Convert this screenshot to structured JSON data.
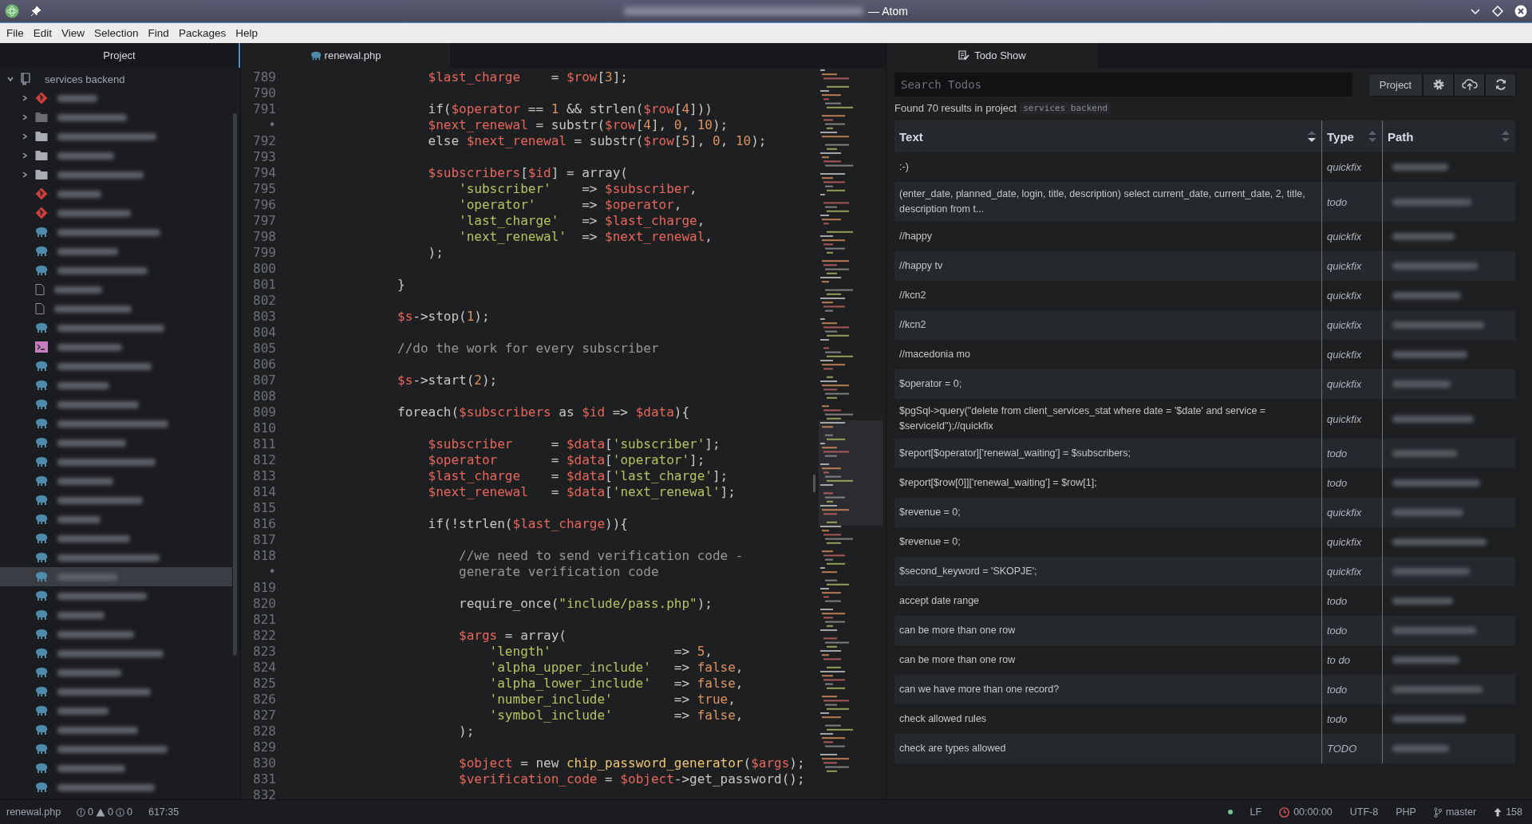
{
  "window": {
    "title": "— Atom"
  },
  "menu": [
    "File",
    "Edit",
    "View",
    "Selection",
    "Find",
    "Packages",
    "Help"
  ],
  "tree": {
    "tab": "Project",
    "root": {
      "label": "services backend",
      "expanded": true
    },
    "items": [
      {
        "kind": "git",
        "expanded": false,
        "selected": false
      },
      {
        "kind": "ignored",
        "expanded": false,
        "selected": false
      },
      {
        "kind": "folder",
        "expanded": false,
        "selected": false
      },
      {
        "kind": "folder",
        "expanded": false,
        "selected": false
      },
      {
        "kind": "folder",
        "expanded": false,
        "selected": false
      },
      {
        "kind": "gitfile",
        "selected": false
      },
      {
        "kind": "gitfile",
        "selected": false
      },
      {
        "kind": "php",
        "selected": false
      },
      {
        "kind": "php",
        "selected": false
      },
      {
        "kind": "php",
        "selected": false
      },
      {
        "kind": "file",
        "selected": false
      },
      {
        "kind": "file",
        "selected": false
      },
      {
        "kind": "php",
        "selected": false
      },
      {
        "kind": "shell",
        "selected": false
      },
      {
        "kind": "php",
        "selected": false
      },
      {
        "kind": "php",
        "selected": false
      },
      {
        "kind": "php",
        "selected": false
      },
      {
        "kind": "php",
        "selected": false
      },
      {
        "kind": "php",
        "selected": false
      },
      {
        "kind": "php",
        "selected": false
      },
      {
        "kind": "php",
        "selected": false
      },
      {
        "kind": "php",
        "selected": false
      },
      {
        "kind": "php",
        "selected": false
      },
      {
        "kind": "php",
        "selected": false
      },
      {
        "kind": "php",
        "selected": false
      },
      {
        "kind": "php",
        "selected": true
      },
      {
        "kind": "php",
        "selected": false
      },
      {
        "kind": "php",
        "selected": false
      },
      {
        "kind": "php",
        "selected": false
      },
      {
        "kind": "php",
        "selected": false
      },
      {
        "kind": "php",
        "selected": false
      },
      {
        "kind": "php",
        "selected": false
      },
      {
        "kind": "php",
        "selected": false
      },
      {
        "kind": "php",
        "selected": false
      },
      {
        "kind": "php",
        "selected": false
      },
      {
        "kind": "php",
        "selected": false
      },
      {
        "kind": "php",
        "selected": false
      }
    ]
  },
  "editor": {
    "tab": "renewal.php",
    "lines": [
      {
        "number": "789",
        "tokens": [
          {
            "kind": "var",
            "text": "    $last_charge"
          },
          {
            "kind": "plain",
            "text": "    = "
          },
          {
            "kind": "var",
            "text": "$row"
          },
          {
            "kind": "plain",
            "text": "["
          },
          {
            "kind": "num",
            "text": "3"
          },
          {
            "kind": "plain",
            "text": "];"
          }
        ]
      },
      {
        "number": "790"
      },
      {
        "number": "791",
        "tokens": [
          {
            "kind": "plain",
            "text": "    if("
          },
          {
            "kind": "var",
            "text": "$operator"
          },
          {
            "kind": "plain",
            "text": " == "
          },
          {
            "kind": "num",
            "text": "1"
          },
          {
            "kind": "plain",
            "text": " && strlen("
          },
          {
            "kind": "var",
            "text": "$row"
          },
          {
            "kind": "plain",
            "text": "["
          },
          {
            "kind": "num",
            "text": "4"
          },
          {
            "kind": "plain",
            "text": "]))"
          }
        ]
      },
      {
        "number": "•",
        "tokens": [
          {
            "kind": "var",
            "text": "    $next_renewal"
          },
          {
            "kind": "plain",
            "text": " = substr("
          },
          {
            "kind": "var",
            "text": "$row"
          },
          {
            "kind": "plain",
            "text": "["
          },
          {
            "kind": "num",
            "text": "4"
          },
          {
            "kind": "plain",
            "text": "], "
          },
          {
            "kind": "num",
            "text": "0"
          },
          {
            "kind": "plain",
            "text": ", "
          },
          {
            "kind": "num",
            "text": "10"
          },
          {
            "kind": "plain",
            "text": ");"
          }
        ]
      },
      {
        "number": "792",
        "tokens": [
          {
            "kind": "plain",
            "text": "    else "
          },
          {
            "kind": "var",
            "text": "$next_renewal"
          },
          {
            "kind": "plain",
            "text": " = substr("
          },
          {
            "kind": "var",
            "text": "$row"
          },
          {
            "kind": "plain",
            "text": "["
          },
          {
            "kind": "num",
            "text": "5"
          },
          {
            "kind": "plain",
            "text": "], "
          },
          {
            "kind": "num",
            "text": "0"
          },
          {
            "kind": "plain",
            "text": ", "
          },
          {
            "kind": "num",
            "text": "10"
          },
          {
            "kind": "plain",
            "text": ");"
          }
        ]
      },
      {
        "number": "793"
      },
      {
        "number": "794",
        "tokens": [
          {
            "kind": "var",
            "text": "    $subscribers"
          },
          {
            "kind": "plain",
            "text": "["
          },
          {
            "kind": "var",
            "text": "$id"
          },
          {
            "kind": "plain",
            "text": "] = array("
          }
        ]
      },
      {
        "number": "795",
        "tokens": [
          {
            "kind": "str",
            "text": "        'subscriber'"
          },
          {
            "kind": "plain",
            "text": "    => "
          },
          {
            "kind": "var",
            "text": "$subscriber"
          },
          {
            "kind": "plain",
            "text": ","
          }
        ]
      },
      {
        "number": "796",
        "tokens": [
          {
            "kind": "str",
            "text": "        'operator'"
          },
          {
            "kind": "plain",
            "text": "      => "
          },
          {
            "kind": "var",
            "text": "$operator"
          },
          {
            "kind": "plain",
            "text": ","
          }
        ]
      },
      {
        "number": "797",
        "tokens": [
          {
            "kind": "str",
            "text": "        'last_charge'"
          },
          {
            "kind": "plain",
            "text": "   => "
          },
          {
            "kind": "var",
            "text": "$last_charge"
          },
          {
            "kind": "plain",
            "text": ","
          }
        ]
      },
      {
        "number": "798",
        "tokens": [
          {
            "kind": "str",
            "text": "        'next_renewal'"
          },
          {
            "kind": "plain",
            "text": "  => "
          },
          {
            "kind": "var",
            "text": "$next_renewal"
          },
          {
            "kind": "plain",
            "text": ","
          }
        ]
      },
      {
        "number": "799",
        "tokens": [
          {
            "kind": "plain",
            "text": "    );"
          }
        ]
      },
      {
        "number": "800"
      },
      {
        "number": "801",
        "tokens": [
          {
            "kind": "plain",
            "text": "}"
          }
        ]
      },
      {
        "number": "802"
      },
      {
        "number": "803",
        "tokens": [
          {
            "kind": "var",
            "text": "$s"
          },
          {
            "kind": "plain",
            "text": "->stop("
          },
          {
            "kind": "num",
            "text": "1"
          },
          {
            "kind": "plain",
            "text": ");"
          }
        ]
      },
      {
        "number": "804"
      },
      {
        "number": "805",
        "tokens": [
          {
            "kind": "comment",
            "text": "//do the work for every subscriber"
          }
        ]
      },
      {
        "number": "806"
      },
      {
        "number": "807",
        "tokens": [
          {
            "kind": "var",
            "text": "$s"
          },
          {
            "kind": "plain",
            "text": "->start("
          },
          {
            "kind": "num",
            "text": "2"
          },
          {
            "kind": "plain",
            "text": ");"
          }
        ]
      },
      {
        "number": "808"
      },
      {
        "number": "809",
        "tokens": [
          {
            "kind": "plain",
            "text": "foreach("
          },
          {
            "kind": "var",
            "text": "$subscribers"
          },
          {
            "kind": "plain",
            "text": " as "
          },
          {
            "kind": "var",
            "text": "$id"
          },
          {
            "kind": "plain",
            "text": " => "
          },
          {
            "kind": "var",
            "text": "$data"
          },
          {
            "kind": "plain",
            "text": "){"
          }
        ]
      },
      {
        "number": "810"
      },
      {
        "number": "811",
        "tokens": [
          {
            "kind": "var",
            "text": "    $subscriber"
          },
          {
            "kind": "plain",
            "text": "     = "
          },
          {
            "kind": "var",
            "text": "$data"
          },
          {
            "kind": "plain",
            "text": "["
          },
          {
            "kind": "str",
            "text": "'subscriber'"
          },
          {
            "kind": "plain",
            "text": "];"
          }
        ]
      },
      {
        "number": "812",
        "tokens": [
          {
            "kind": "var",
            "text": "    $operator"
          },
          {
            "kind": "plain",
            "text": "       = "
          },
          {
            "kind": "var",
            "text": "$data"
          },
          {
            "kind": "plain",
            "text": "["
          },
          {
            "kind": "str",
            "text": "'operator'"
          },
          {
            "kind": "plain",
            "text": "];"
          }
        ]
      },
      {
        "number": "813",
        "tokens": [
          {
            "kind": "var",
            "text": "    $last_charge"
          },
          {
            "kind": "plain",
            "text": "    = "
          },
          {
            "kind": "var",
            "text": "$data"
          },
          {
            "kind": "plain",
            "text": "["
          },
          {
            "kind": "str",
            "text": "'last_charge'"
          },
          {
            "kind": "plain",
            "text": "];"
          }
        ]
      },
      {
        "number": "814",
        "tokens": [
          {
            "kind": "var",
            "text": "    $next_renewal"
          },
          {
            "kind": "plain",
            "text": "   = "
          },
          {
            "kind": "var",
            "text": "$data"
          },
          {
            "kind": "plain",
            "text": "["
          },
          {
            "kind": "str",
            "text": "'next_renewal'"
          },
          {
            "kind": "plain",
            "text": "];"
          }
        ]
      },
      {
        "number": "815"
      },
      {
        "number": "816",
        "tokens": [
          {
            "kind": "plain",
            "text": "    if(!strlen("
          },
          {
            "kind": "var",
            "text": "$last_charge"
          },
          {
            "kind": "plain",
            "text": ")){"
          }
        ]
      },
      {
        "number": "817"
      },
      {
        "number": "818",
        "tokens": [
          {
            "kind": "comment",
            "text": "        //we need to send verification code -"
          }
        ]
      },
      {
        "number": "•",
        "tokens": [
          {
            "kind": "comment",
            "text": "        generate verification code"
          }
        ]
      },
      {
        "number": "819"
      },
      {
        "number": "820",
        "tokens": [
          {
            "kind": "plain",
            "text": "        require_once("
          },
          {
            "kind": "str",
            "text": "\"include/pass.php\""
          },
          {
            "kind": "plain",
            "text": ");"
          }
        ]
      },
      {
        "number": "821"
      },
      {
        "number": "822",
        "tokens": [
          {
            "kind": "var",
            "text": "        $args"
          },
          {
            "kind": "plain",
            "text": " = array("
          }
        ]
      },
      {
        "number": "823",
        "tokens": [
          {
            "kind": "str",
            "text": "            'length'"
          },
          {
            "kind": "plain",
            "text": "                => "
          },
          {
            "kind": "num",
            "text": "5"
          },
          {
            "kind": "plain",
            "text": ","
          }
        ]
      },
      {
        "number": "824",
        "tokens": [
          {
            "kind": "str",
            "text": "            'alpha_upper_include'"
          },
          {
            "kind": "plain",
            "text": "   => "
          },
          {
            "kind": "num",
            "text": "false"
          },
          {
            "kind": "plain",
            "text": ","
          }
        ]
      },
      {
        "number": "825",
        "tokens": [
          {
            "kind": "str",
            "text": "            'alpha_lower_include'"
          },
          {
            "kind": "plain",
            "text": "   => "
          },
          {
            "kind": "num",
            "text": "false"
          },
          {
            "kind": "plain",
            "text": ","
          }
        ]
      },
      {
        "number": "826",
        "tokens": [
          {
            "kind": "str",
            "text": "            'number_include'"
          },
          {
            "kind": "plain",
            "text": "        => "
          },
          {
            "kind": "num",
            "text": "true"
          },
          {
            "kind": "plain",
            "text": ","
          }
        ]
      },
      {
        "number": "827",
        "tokens": [
          {
            "kind": "str",
            "text": "            'symbol_include'"
          },
          {
            "kind": "plain",
            "text": "        => "
          },
          {
            "kind": "num",
            "text": "false"
          },
          {
            "kind": "plain",
            "text": ","
          }
        ]
      },
      {
        "number": "828",
        "tokens": [
          {
            "kind": "plain",
            "text": "        );"
          }
        ]
      },
      {
        "number": "829"
      },
      {
        "number": "830",
        "tokens": [
          {
            "kind": "var",
            "text": "        $object"
          },
          {
            "kind": "plain",
            "text": " = new "
          },
          {
            "kind": "func",
            "text": "chip_password_generator"
          },
          {
            "kind": "plain",
            "text": "("
          },
          {
            "kind": "var",
            "text": "$args"
          },
          {
            "kind": "plain",
            "text": ");"
          }
        ]
      },
      {
        "number": "831",
        "tokens": [
          {
            "kind": "var",
            "text": "        $verification_code"
          },
          {
            "kind": "plain",
            "text": " = "
          },
          {
            "kind": "var",
            "text": "$object"
          },
          {
            "kind": "plain",
            "text": "->get_password();"
          }
        ]
      },
      {
        "number": "832"
      }
    ]
  },
  "todo": {
    "tab": "Todo Show",
    "search": {
      "placeholder": "Search Todos"
    },
    "scope_button": "Project",
    "summary": "Found 70 results in project",
    "project": "services backend",
    "columns": [
      {
        "label": "Text",
        "sorted": true
      },
      {
        "label": "Type",
        "sorted": false
      },
      {
        "label": "Path",
        "sorted": false
      }
    ],
    "rows": [
      {
        "text": ":-)",
        "type": "quickfix"
      },
      {
        "text": "(enter_date, planned_date, login, title, description) select current_date, current_date, 2, title, description from t...",
        "type": "todo"
      },
      {
        "text": "//happy",
        "type": "quickfix"
      },
      {
        "text": "//happy tv",
        "type": "quickfix"
      },
      {
        "text": "//kcn2",
        "type": "quickfix"
      },
      {
        "text": "//kcn2",
        "type": "quickfix"
      },
      {
        "text": "//macedonia mo",
        "type": "quickfix"
      },
      {
        "text": "$operator = 0;",
        "type": "quickfix"
      },
      {
        "text": "$pgSql->query(\"delete from client_services_stat where date = '$date' and service = $serviceId\");//quickfix",
        "type": "quickfix"
      },
      {
        "text": "$report[$operator]['renewal_waiting'] = $subscribers;",
        "type": "todo"
      },
      {
        "text": "$report[$row[0]]['renewal_waiting'] = $row[1];",
        "type": "todo"
      },
      {
        "text": "$revenue = 0;",
        "type": "quickfix"
      },
      {
        "text": "$revenue = 0;",
        "type": "quickfix"
      },
      {
        "text": "$second_keyword = 'SKOPJE';",
        "type": "quickfix"
      },
      {
        "text": "accept date range",
        "type": "todo"
      },
      {
        "text": "can be more than one row",
        "type": "todo"
      },
      {
        "text": "can be more than one row",
        "type": "to do"
      },
      {
        "text": "can we have more than one record?",
        "type": "todo"
      },
      {
        "text": "check allowed rules",
        "type": "todo"
      },
      {
        "text": "check are types allowed",
        "type": "TODO"
      }
    ]
  },
  "status_bar": {
    "file": "renewal.php",
    "errors": "0",
    "warnings": "0",
    "infos": "0",
    "cursor": "617:35",
    "line_ending": "LF",
    "timer": "00:00:00",
    "encoding": "UTF-8",
    "grammar": "PHP",
    "branch": "master",
    "ahead": "158"
  }
}
